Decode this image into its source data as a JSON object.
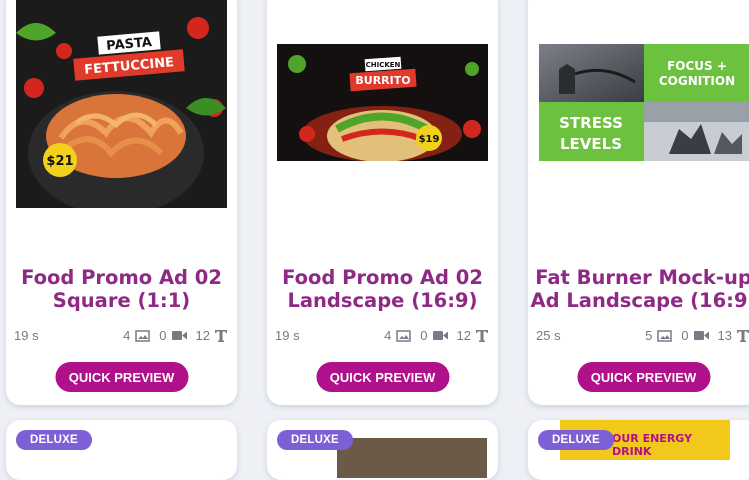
{
  "cards": [
    {
      "title_line1": "Food Promo Ad 02",
      "title_line2": "Square (1:1)",
      "duration": "19 s",
      "images": "4",
      "videos": "0",
      "texts": "12",
      "preview_label": "QUICK PREVIEW",
      "thumb": {
        "word1": "PASTA",
        "word2": "FETTUCCINE",
        "price": "$21"
      }
    },
    {
      "title_line1": "Food Promo Ad 02",
      "title_line2": "Landscape (16:9)",
      "duration": "19 s",
      "images": "4",
      "videos": "0",
      "texts": "12",
      "preview_label": "QUICK PREVIEW",
      "thumb": {
        "word1": "CHICKEN",
        "word2": "BURRITO",
        "price": "$19"
      }
    },
    {
      "title_line1": "Fat Burner Mock-up",
      "title_line2": "Ad Landscape (16:9)",
      "duration": "25 s",
      "images": "5",
      "videos": "0",
      "texts": "13",
      "preview_label": "QUICK PREVIEW",
      "thumb": {
        "line1": "FOCUS +",
        "line2": "COGNITION",
        "line3": "STRESS",
        "line4": "LEVELS"
      }
    }
  ],
  "next_row": [
    {
      "badge": "DELUXE"
    },
    {
      "badge": "DELUXE"
    },
    {
      "badge": "DELUXE",
      "snippet": "OUR ENERGY DRINK"
    }
  ],
  "colors": {
    "title": "#8e2a86",
    "button": "#b0108a",
    "badge": "#7d5fd6",
    "green": "#6cc13f"
  }
}
